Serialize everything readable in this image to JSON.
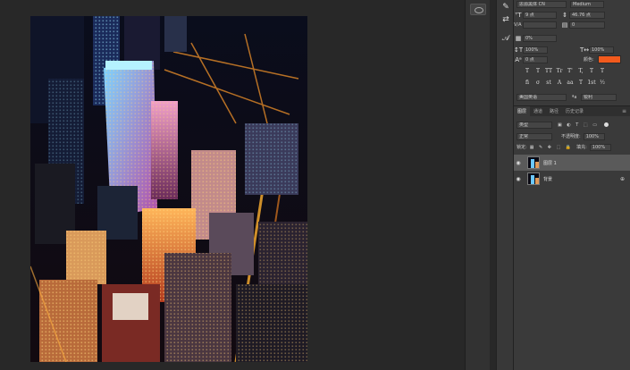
{
  "character": {
    "font_family": "思源黑体 CN",
    "font_style": "Medium",
    "font_size": "9 点",
    "leading": "46.76 点",
    "kerning_label": "V/A",
    "tracking": "0",
    "scale_pct": "0%",
    "vertical_scale": "100%",
    "horizontal_scale": "100%",
    "baseline_shift": "0 点",
    "color_label": "颜色:",
    "text_color": "#f25a1d",
    "glyphs": [
      "T",
      "T",
      "TT",
      "Tr",
      "T'",
      "T,",
      "T",
      "T"
    ],
    "glyphs2": [
      "fi",
      "σ",
      "st",
      "A",
      "aa",
      "T",
      "1st",
      "½"
    ],
    "language": "美国英语",
    "antialias": "锐利"
  },
  "layers_panel": {
    "tabs": [
      "图层",
      "通道",
      "路径",
      "历史记录"
    ],
    "filter_label": "类型",
    "blend_mode": "正常",
    "opacity_label": "不透明度:",
    "opacity_value": "100%",
    "lock_label": "锁定:",
    "fill_label": "填充:",
    "fill_value": "100%",
    "layers": [
      {
        "name": "图层 1",
        "visible": true,
        "selected": true,
        "locked": false
      },
      {
        "name": "背景",
        "visible": true,
        "selected": false,
        "locked": true
      }
    ]
  },
  "icons": {
    "eye": "eye-icon",
    "lock": "lock-icon",
    "brush": "brush-icon",
    "mini": "panel-collapse-icon"
  }
}
